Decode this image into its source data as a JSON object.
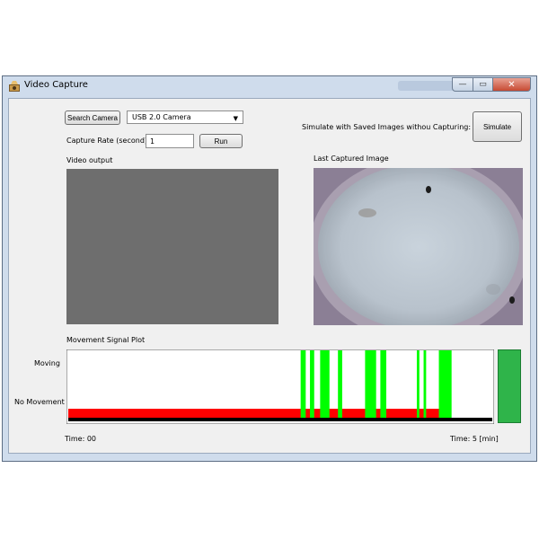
{
  "window": {
    "title": "Video Capture",
    "min_glyph": "—",
    "max_glyph": "▭",
    "close_glyph": "✕"
  },
  "controls": {
    "search_camera_label": "Search Camera",
    "camera_selected": "USB 2.0 Camera",
    "capture_rate_label": "Capture Rate (second):",
    "capture_rate_value": "1",
    "run_label": "Run",
    "simulate_text": "Simulate with Saved Images withou Capturing:",
    "simulate_label": "Simulate"
  },
  "panels": {
    "video_output_label": "Video output",
    "last_captured_label": "Last Captured Image",
    "movement_plot_label": "Movement Signal Plot"
  },
  "plot": {
    "moving_label": "Moving",
    "no_movement_label": "No Movement",
    "time_start_label": "Time: 00",
    "time_end_label": "Time: 5 [min]"
  },
  "colors": {
    "moving": "#00ff00",
    "no_movement": "#ff0000",
    "baseline": "#000000",
    "indicator": "#2fb44a"
  },
  "chart_data": {
    "type": "bar",
    "x_unit": "min",
    "xlim": [
      0,
      5
    ],
    "levels": [
      "No Movement",
      "Moving"
    ],
    "no_movement_range": [
      0,
      4.45
    ],
    "moving_intervals": [
      [
        2.74,
        2.8
      ],
      [
        2.85,
        2.9
      ],
      [
        2.97,
        3.08
      ],
      [
        3.18,
        3.23
      ],
      [
        3.5,
        3.63
      ],
      [
        3.68,
        3.75
      ],
      [
        4.11,
        4.14
      ],
      [
        4.19,
        4.22
      ],
      [
        4.37,
        4.52
      ]
    ]
  }
}
